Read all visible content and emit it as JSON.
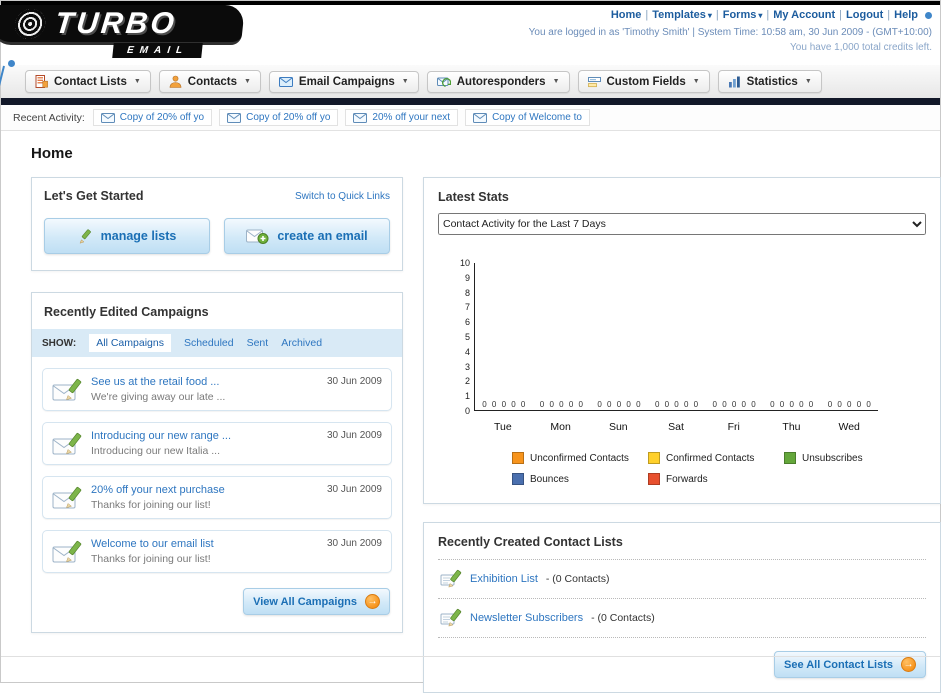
{
  "header": {
    "logo": {
      "line1": "TURBO",
      "line2": "EMAIL"
    },
    "links": [
      {
        "label": "Home",
        "dropdown": false
      },
      {
        "label": "Templates",
        "dropdown": true
      },
      {
        "label": "Forms",
        "dropdown": true
      },
      {
        "label": "My Account",
        "dropdown": false
      },
      {
        "label": "Logout",
        "dropdown": false
      },
      {
        "label": "Help",
        "dropdown": false
      }
    ],
    "login_line": "You are logged in as 'Timothy Smith' | System Time: 10:58 am, 30 Jun 2009 - (GMT+10:00)",
    "credits_line": "You have 1,000 total credits left."
  },
  "nav": {
    "tabs": [
      {
        "label": "Contact Lists",
        "icon": "contact-lists-icon"
      },
      {
        "label": "Contacts",
        "icon": "contacts-icon"
      },
      {
        "label": "Email Campaigns",
        "icon": "email-campaigns-icon"
      },
      {
        "label": "Autoresponders",
        "icon": "autoresponders-icon"
      },
      {
        "label": "Custom Fields",
        "icon": "custom-fields-icon"
      },
      {
        "label": "Statistics",
        "icon": "statistics-icon"
      }
    ]
  },
  "recent_activity": {
    "label": "Recent Activity:",
    "items": [
      "Copy of 20% off yo",
      "Copy of 20% off yo",
      "20% off your next",
      "Copy of Welcome to"
    ]
  },
  "page": {
    "title": "Home"
  },
  "get_started": {
    "title": "Let's Get Started",
    "switch_link": "Switch to Quick Links",
    "buttons": [
      {
        "label": "manage lists",
        "icon": "pencil-icon"
      },
      {
        "label": "create an email",
        "icon": "envelope-plus-icon"
      }
    ]
  },
  "campaigns": {
    "title": "Recently Edited Campaigns",
    "show_label": "SHOW:",
    "filters": [
      "All Campaigns",
      "Scheduled",
      "Sent",
      "Archived"
    ],
    "active_filter": "All Campaigns",
    "rows": [
      {
        "title": "See us at the retail food ...",
        "subtitle": "We're giving away our late ...",
        "date": "30 Jun 2009"
      },
      {
        "title": "Introducing our new range ...",
        "subtitle": "Introducing our new Italia ...",
        "date": "30 Jun 2009"
      },
      {
        "title": "20% off your next purchase",
        "subtitle": "Thanks for joining our list!",
        "date": "30 Jun 2009"
      },
      {
        "title": "Welcome to our email list",
        "subtitle": "Thanks for joining our list!",
        "date": "30 Jun 2009"
      }
    ],
    "view_all_label": "View All Campaigns"
  },
  "stats": {
    "title": "Latest Stats",
    "dropdown_value": "Contact Activity for the Last 7 Days"
  },
  "chart_data": {
    "type": "bar",
    "title": "Contact Activity for the Last 7 Days",
    "categories": [
      "Tue",
      "Mon",
      "Sun",
      "Sat",
      "Fri",
      "Thu",
      "Wed"
    ],
    "series": [
      {
        "name": "Unconfirmed Contacts",
        "color": "#f7941d",
        "values": [
          0,
          0,
          0,
          0,
          0,
          0,
          0
        ]
      },
      {
        "name": "Confirmed Contacts",
        "color": "#ffd02b",
        "values": [
          0,
          0,
          0,
          0,
          0,
          0,
          0
        ]
      },
      {
        "name": "Unsubscribes",
        "color": "#64a73b",
        "values": [
          0,
          0,
          0,
          0,
          0,
          0,
          0
        ]
      },
      {
        "name": "Bounces",
        "color": "#4a6fae",
        "values": [
          0,
          0,
          0,
          0,
          0,
          0,
          0
        ]
      },
      {
        "name": "Forwards",
        "color": "#e8502e",
        "values": [
          0,
          0,
          0,
          0,
          0,
          0,
          0
        ]
      }
    ],
    "ylim": [
      0,
      10
    ],
    "yticks": [
      10,
      9,
      8,
      7,
      6,
      5,
      4,
      3,
      2,
      1,
      0
    ],
    "grid": false,
    "legend_position": "bottom"
  },
  "contact_lists": {
    "title": "Recently Created Contact Lists",
    "items": [
      {
        "name": "Exhibition List",
        "detail": "- (0 Contacts)"
      },
      {
        "name": "Newsletter Subscribers",
        "detail": "- (0 Contacts)"
      }
    ],
    "see_all_label": "See All Contact Lists"
  }
}
